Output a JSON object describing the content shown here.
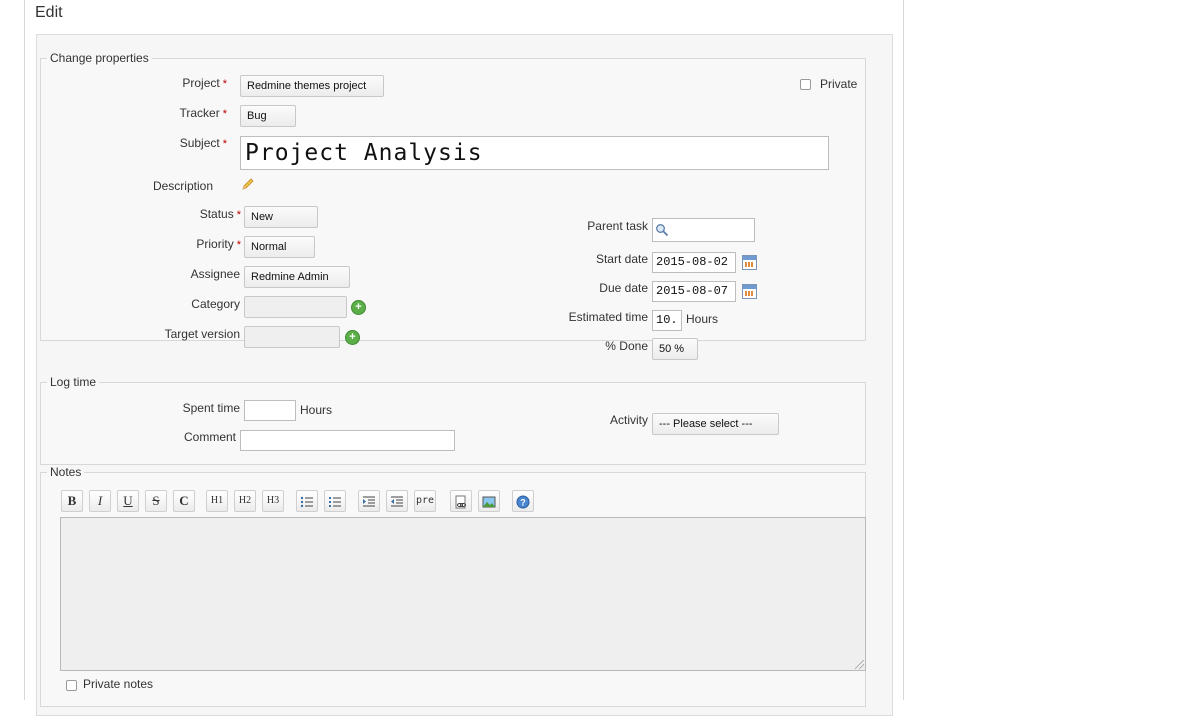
{
  "page": {
    "title": "Edit"
  },
  "properties": {
    "legend": "Change properties",
    "project": {
      "label": "Project",
      "value": "Redmine themes project"
    },
    "private": {
      "label": "Private"
    },
    "tracker": {
      "label": "Tracker",
      "value": "Bug"
    },
    "subject": {
      "label": "Subject",
      "value": "Project Analysis"
    },
    "description": {
      "label": "Description"
    },
    "status": {
      "label": "Status",
      "value": "New"
    },
    "priority": {
      "label": "Priority",
      "value": "Normal"
    },
    "assignee": {
      "label": "Assignee",
      "value": "Redmine Admin"
    },
    "category": {
      "label": "Category",
      "value": ""
    },
    "target_version": {
      "label": "Target version",
      "value": ""
    },
    "parent_task": {
      "label": "Parent task",
      "value": ""
    },
    "start_date": {
      "label": "Start date",
      "value": "2015-08-02"
    },
    "due_date": {
      "label": "Due date",
      "value": "2015-08-07"
    },
    "estimated_time": {
      "label": "Estimated time",
      "value": "10.",
      "unit": "Hours"
    },
    "done": {
      "label": "% Done",
      "value": "50 %"
    }
  },
  "log_time": {
    "legend": "Log time",
    "spent_time": {
      "label": "Spent time",
      "value": "",
      "unit": "Hours"
    },
    "comment": {
      "label": "Comment",
      "value": ""
    },
    "activity": {
      "label": "Activity",
      "value": "--- Please select ---"
    }
  },
  "notes": {
    "legend": "Notes",
    "toolbar": [
      "B",
      "I",
      "U",
      "S",
      "C",
      "H1",
      "H2",
      "H3",
      "pre"
    ],
    "private_notes_label": "Private notes"
  },
  "icons": {
    "description": "pencil-icon",
    "add": "plus-icon",
    "calendar": "calendar-icon",
    "search": "search-icon"
  },
  "colors": {
    "required": "#bb0000",
    "add_button": "#5cae48"
  }
}
